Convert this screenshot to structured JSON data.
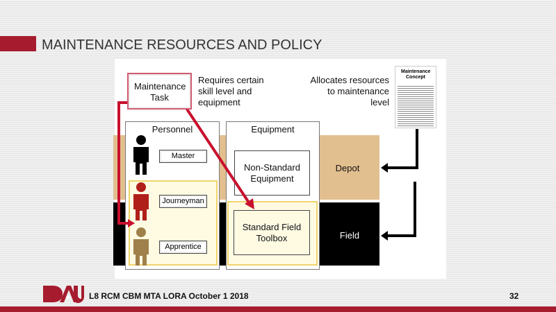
{
  "slide": {
    "title": "MAINTENANCE RESOURCES AND POLICY",
    "footer": "L8 RCM CBM MTA LORA October 1 2018",
    "page_number": "32",
    "logo": "DAU"
  },
  "diagram": {
    "task": "Maintenance Task",
    "requires": "Requires certain skill level and equipment",
    "allocates": "Allocates resources to maintenance level",
    "concept_doc": "Maintenance Concept",
    "personnel": {
      "heading": "Personnel",
      "levels": [
        "Master",
        "Journeyman",
        "Apprentice"
      ]
    },
    "equipment": {
      "heading": "Equipment",
      "non_standard": "Non-Standard Equipment",
      "standard": "Standard Field Toolbox"
    },
    "maintenance_levels": [
      "Depot",
      "Field"
    ]
  },
  "colors": {
    "accent": "#a61c2e",
    "depot": "#e2bf8f",
    "field": "#000000",
    "highlight": "#fffbe3",
    "master": "#000000",
    "journeyman": "#b01f1a",
    "apprentice": "#a0804a"
  }
}
